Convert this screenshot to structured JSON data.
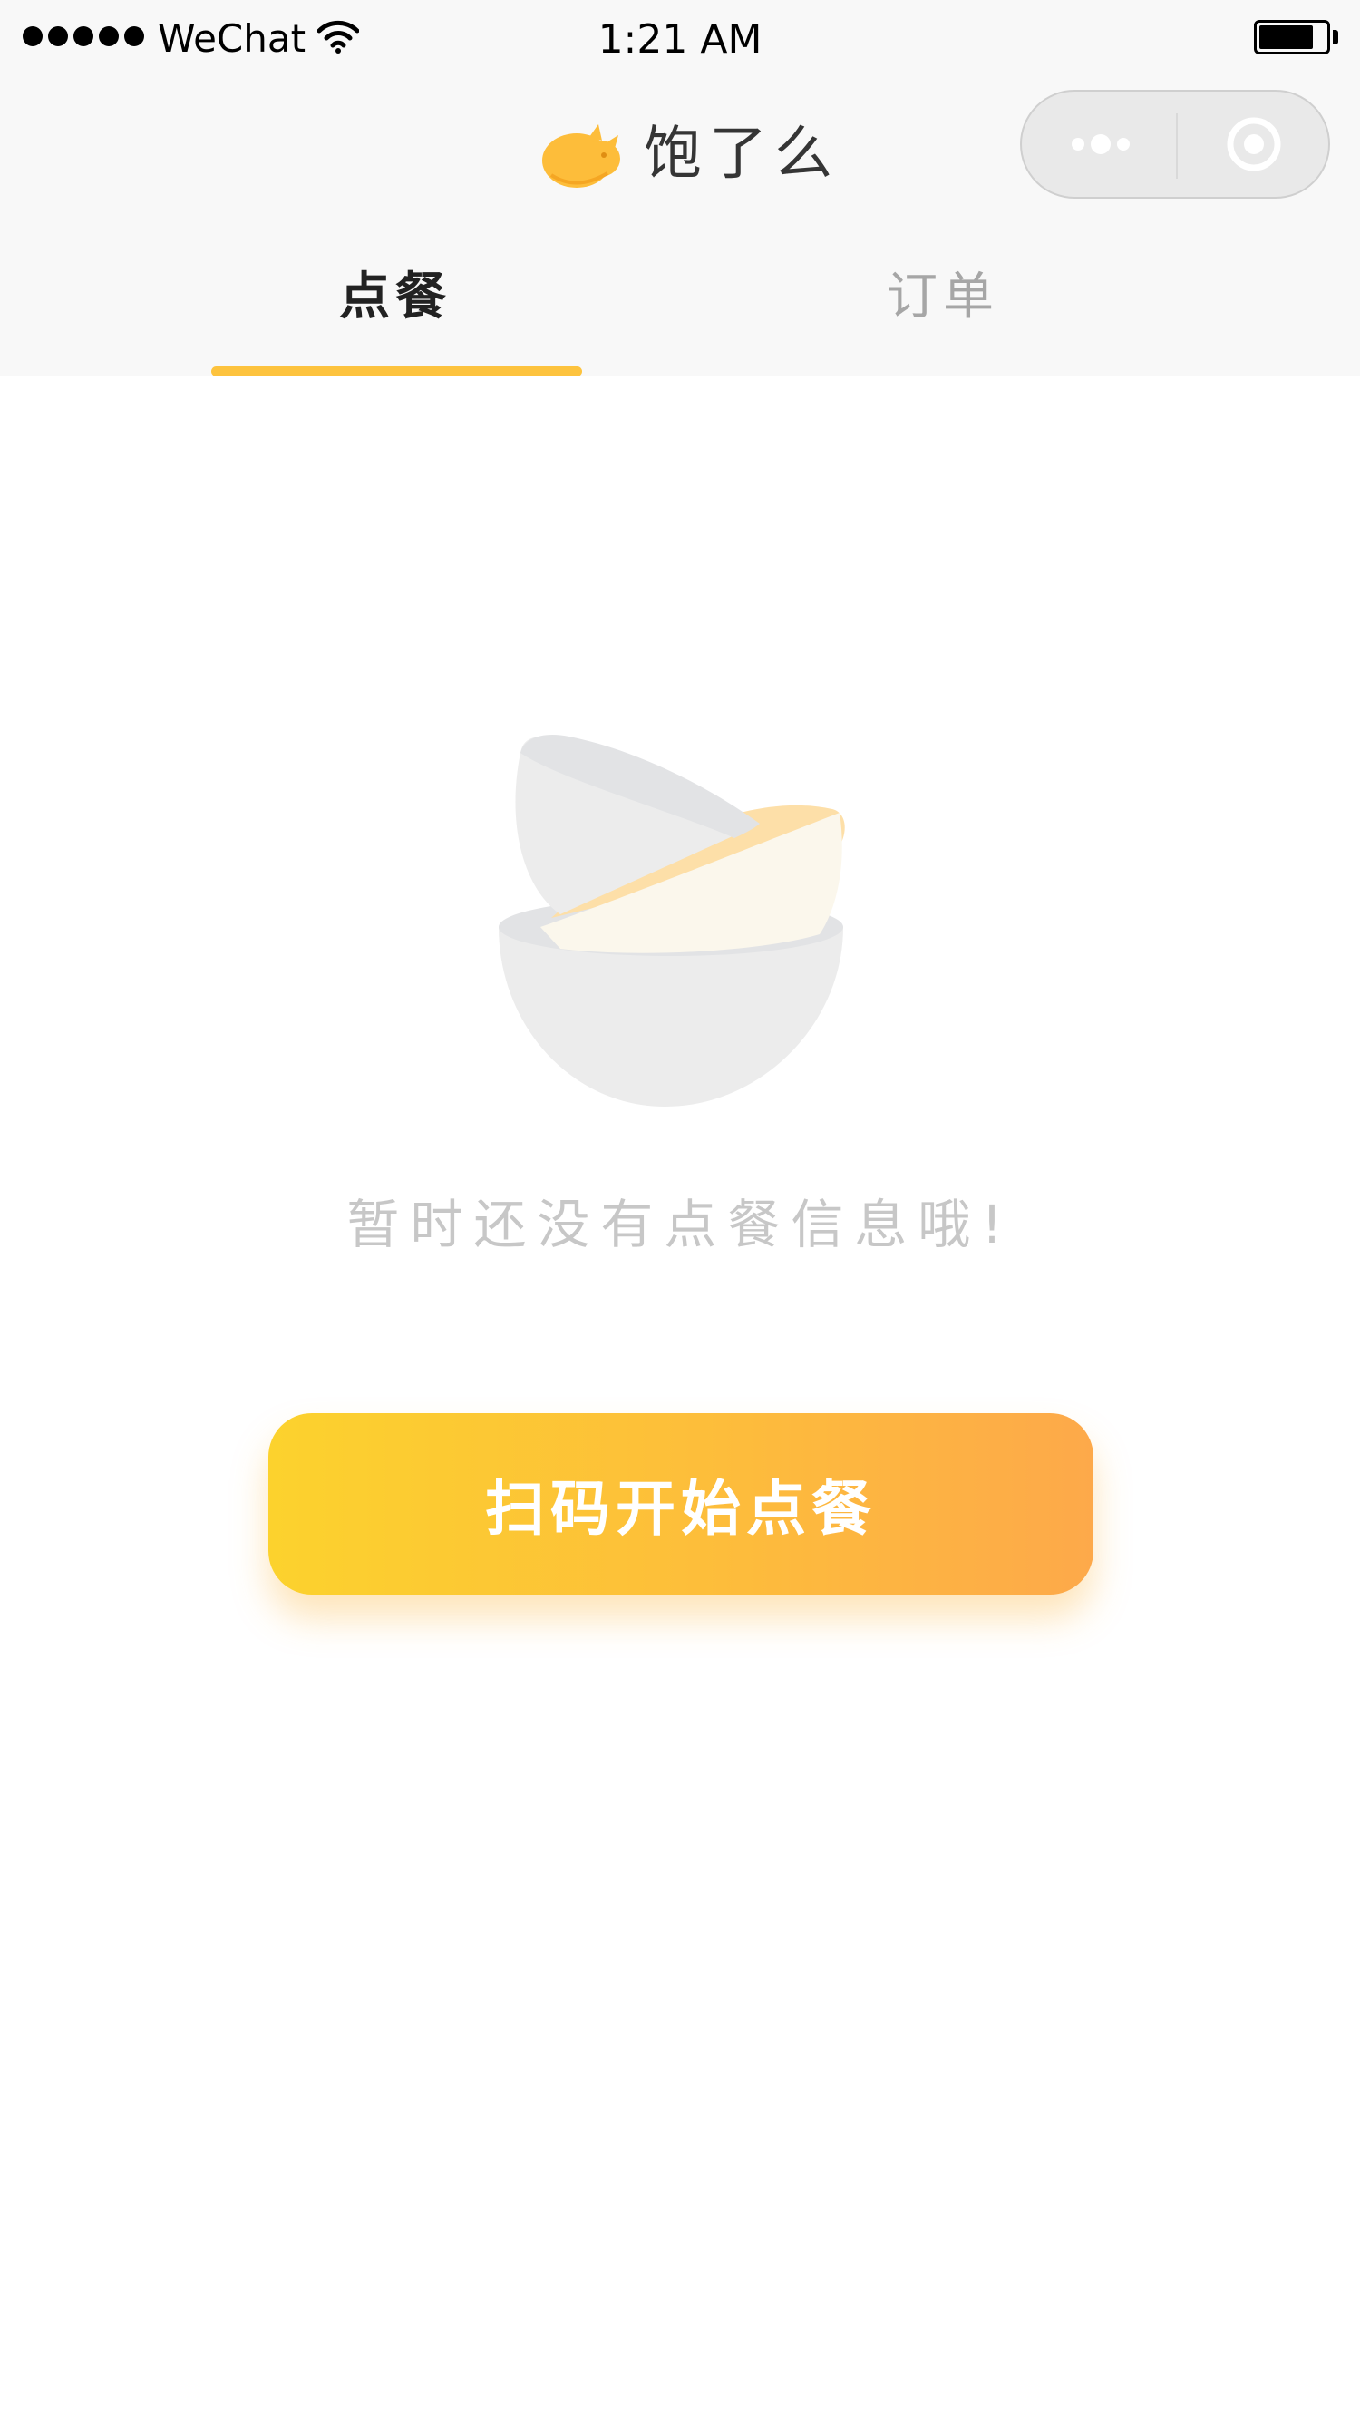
{
  "status_bar": {
    "carrier": "WeChat",
    "time": "1:21 AM",
    "signal_strength": 5,
    "battery_level": 0.82
  },
  "nav": {
    "title": "饱了么",
    "logo_icon": "orange-cat-logo-icon",
    "capsule": {
      "more_icon": "more-dots-icon",
      "close_icon": "close-circle-icon"
    }
  },
  "tabs": [
    {
      "label": "点餐",
      "active": true
    },
    {
      "label": "订单",
      "active": false
    }
  ],
  "empty_state": {
    "illustration_icon": "stacked-bowls-icon",
    "message": "暂时还没有点餐信息哦!"
  },
  "primary_action": {
    "label": "扫码开始点餐"
  },
  "colors": {
    "accent": "#fdc33e",
    "button_gradient_start": "#fcd22d",
    "button_gradient_end": "#fda94a",
    "muted_text": "#c7c7c7"
  }
}
